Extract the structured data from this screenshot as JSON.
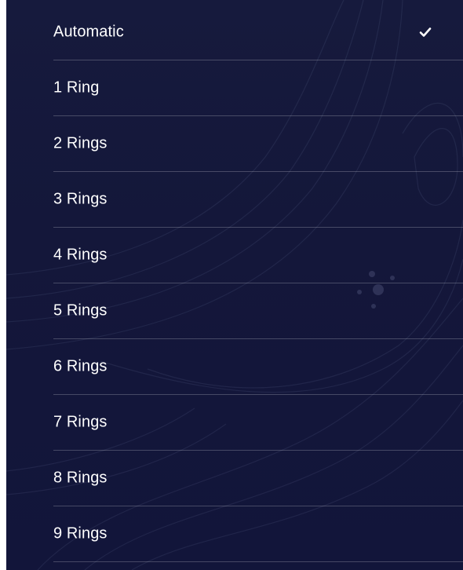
{
  "menu": {
    "items": [
      {
        "label": "Automatic",
        "selected": true
      },
      {
        "label": "1 Ring",
        "selected": false
      },
      {
        "label": "2 Rings",
        "selected": false
      },
      {
        "label": "3 Rings",
        "selected": false
      },
      {
        "label": "4 Rings",
        "selected": false
      },
      {
        "label": "5 Rings",
        "selected": false
      },
      {
        "label": "6 Rings",
        "selected": false
      },
      {
        "label": "7 Rings",
        "selected": false
      },
      {
        "label": "8 Rings",
        "selected": false
      },
      {
        "label": "9 Rings",
        "selected": false
      }
    ]
  },
  "icons": {
    "selected_indicator": "checkmark-icon"
  },
  "colors": {
    "background": "#14173a",
    "text": "#ffffff",
    "divider": "rgba(255,255,255,0.22)"
  }
}
